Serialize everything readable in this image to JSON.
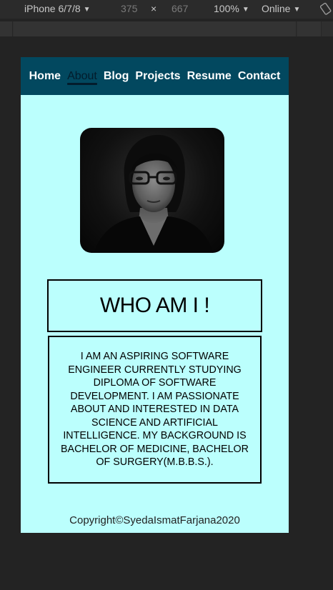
{
  "devtools": {
    "device": "iPhone 6/7/8",
    "width": "375",
    "times": "×",
    "height": "667",
    "zoom": "100%",
    "network": "Online"
  },
  "nav": {
    "items": [
      "Home",
      "About",
      "Blog",
      "Projects",
      "Resume",
      "Contact"
    ],
    "active": "About"
  },
  "profile": {
    "photo_alt": "profile photo"
  },
  "heading": "WHO AM I !",
  "bio": "I AM AN ASPIRING SOFTWARE ENGINEER CURRENTLY STUDYING DIPLOMA OF SOFTWARE DEVELOPMENT. I AM PASSIONATE ABOUT AND INTERESTED IN DATA SCIENCE AND ARTIFICIAL INTELLIGENCE. MY BACKGROUND IS BACHELOR OF MEDICINE, BACHELOR OF SURGERY(M.B.B.S.).",
  "footer": "Copyright©SyedaIsmatFarjana2020",
  "colors": {
    "nav_bg": "#02485f",
    "page_bg": "#bbfffd",
    "active_link": "#031c2c"
  }
}
